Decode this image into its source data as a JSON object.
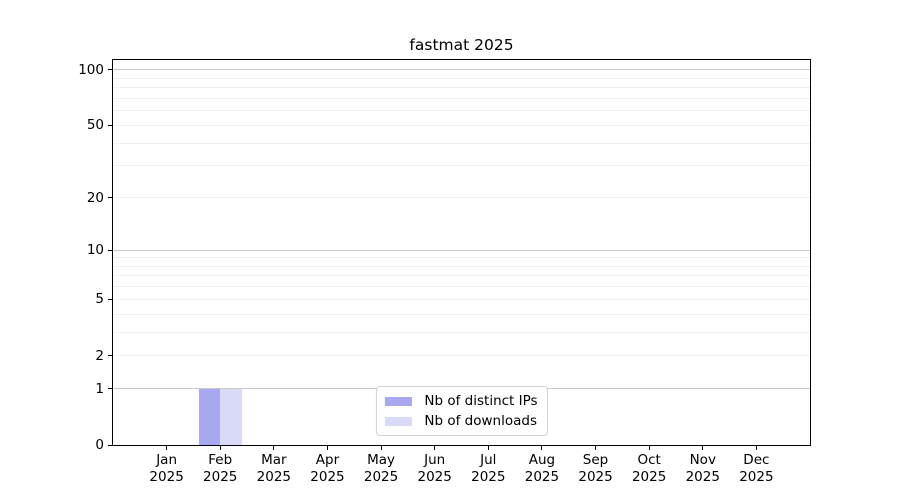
{
  "chart_data": {
    "type": "bar",
    "title": "fastmat 2025",
    "categories": [
      "Jan",
      "Feb",
      "Mar",
      "Apr",
      "May",
      "Jun",
      "Jul",
      "Aug",
      "Sep",
      "Oct",
      "Nov",
      "Dec"
    ],
    "category_year_line": "2025",
    "series": [
      {
        "name": "Nb of distinct IPs",
        "color": "#a8a8f1",
        "values": [
          0,
          1,
          0,
          0,
          0,
          0,
          0,
          0,
          0,
          0,
          0,
          0
        ]
      },
      {
        "name": "Nb of downloads",
        "color": "#d9d9f8",
        "values": [
          0,
          1,
          0,
          0,
          0,
          0,
          0,
          0,
          0,
          0,
          0,
          0
        ]
      }
    ],
    "yscale": "log1p",
    "ylim": [
      0,
      113
    ],
    "ytick_values": [
      0,
      1,
      2,
      5,
      10,
      20,
      50,
      100
    ],
    "ytick_labels": [
      "0",
      "1",
      "2",
      "5",
      "10",
      "20",
      "50",
      "100"
    ],
    "major_gridline_values": [
      1,
      10,
      100
    ],
    "minor_gridline_values": [
      2,
      3,
      4,
      5,
      6,
      7,
      8,
      9,
      20,
      30,
      40,
      50,
      60,
      70,
      80,
      90
    ],
    "grid": "horizontal",
    "legend_position": "lower center",
    "bar_width_fraction": 0.4,
    "colors": {
      "major_grid": "#c9c9c9",
      "minor_grid": "#f0f0f0",
      "axis": "#000000",
      "background": "#ffffff"
    }
  }
}
